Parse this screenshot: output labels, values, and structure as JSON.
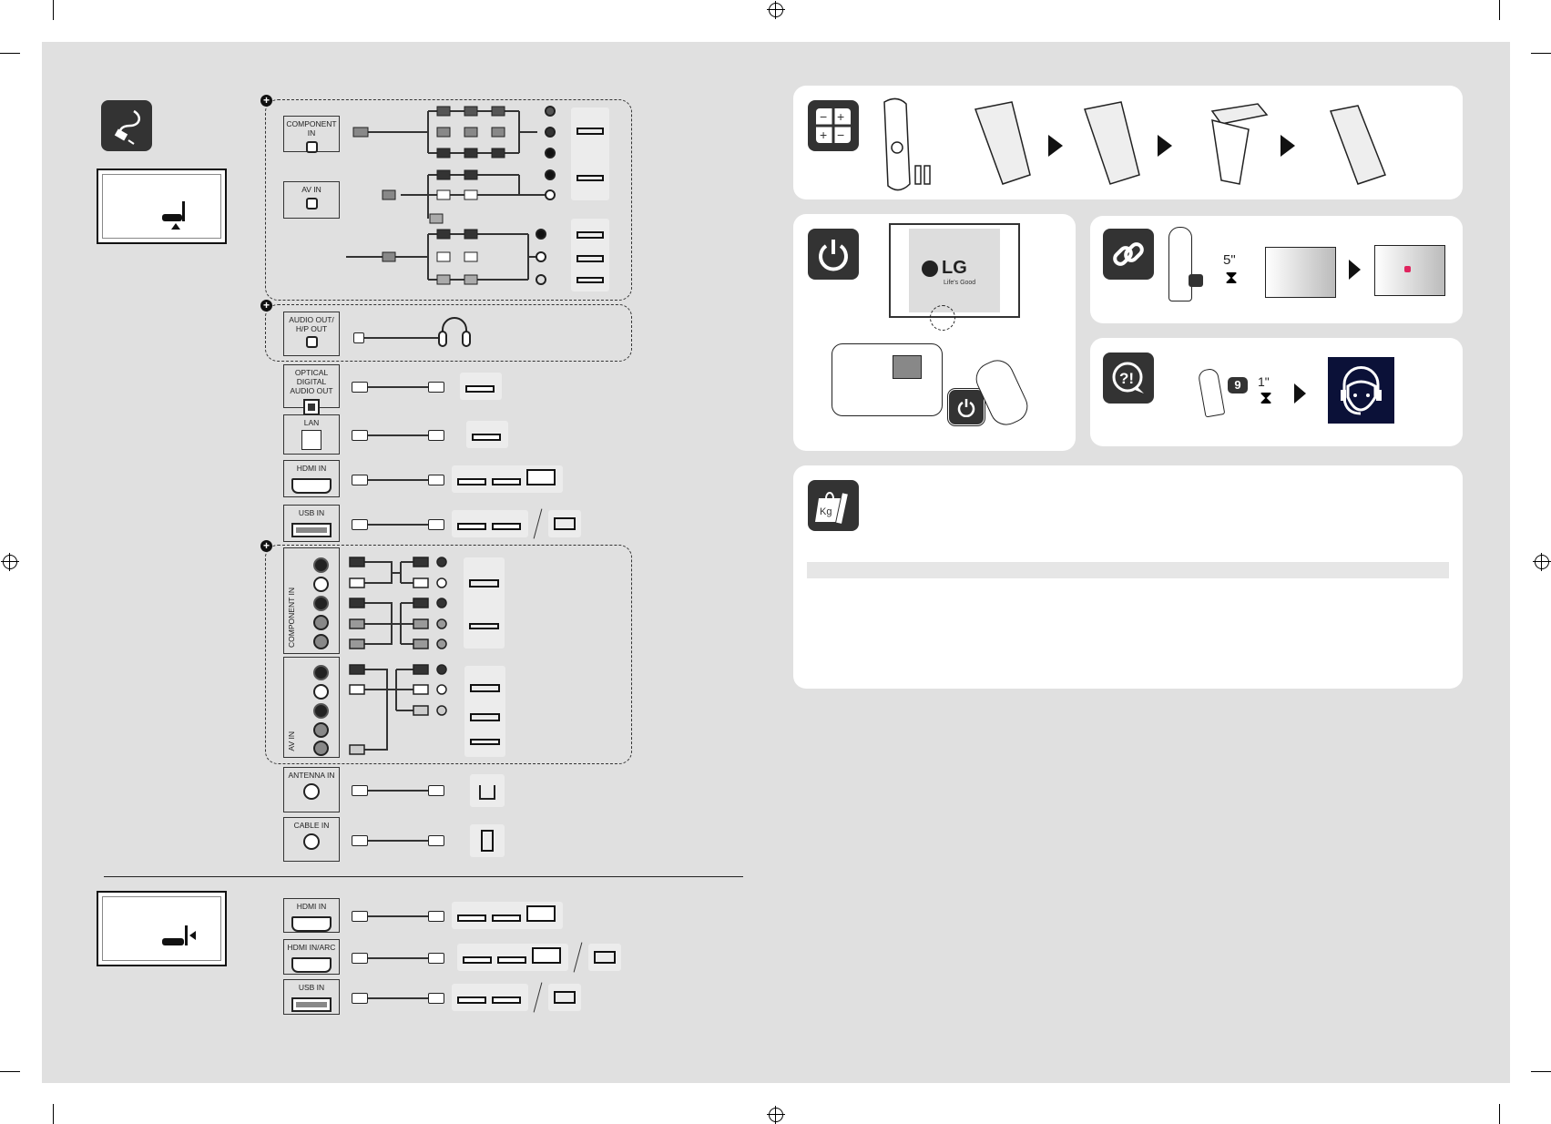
{
  "left_section": {
    "icon": "cable-plug-icon",
    "group_marker": "+",
    "ports_top": [
      {
        "id": "component-in",
        "label": "COMPONENT IN"
      },
      {
        "id": "av-in",
        "label": "AV IN"
      }
    ],
    "audio_out": {
      "label": "AUDIO OUT/ H/P OUT"
    },
    "ports_simple": [
      {
        "id": "optical",
        "label": "OPTICAL DIGITAL AUDIO OUT",
        "jack": "optical",
        "devices": [
          "speaker-system-icon"
        ]
      },
      {
        "id": "lan",
        "label": "LAN",
        "jack": "lan",
        "devices": [
          "router-icon"
        ]
      },
      {
        "id": "hdmi",
        "label": "HDMI IN",
        "jack": "hdmi",
        "devices": [
          "set-top-box-icon",
          "dvd-player-icon",
          "laptop-icon"
        ]
      },
      {
        "id": "usb",
        "label": "USB IN",
        "jack": "usb",
        "devices": [
          "hard-drive-icon",
          "external-disk-icon"
        ],
        "alt_device": "usb-stick-icon"
      }
    ],
    "rca_groups": [
      {
        "id": "component-rca",
        "label": "COMPONENT IN"
      },
      {
        "id": "av-rca",
        "label": "AV IN"
      }
    ],
    "rf_ports": [
      {
        "id": "antenna",
        "label": "ANTENNA IN",
        "device": "house-antenna-icon"
      },
      {
        "id": "cable",
        "label": "CABLE IN",
        "device": "wall-outlet-icon"
      }
    ],
    "side_ports": [
      {
        "id": "hdmi-side",
        "label": "HDMI IN",
        "devices": [
          "set-top-box-icon",
          "dvd-player-icon",
          "laptop-icon"
        ]
      },
      {
        "id": "hdmi-arc",
        "label": "HDMI IN/ARC",
        "devices": [
          "set-top-box-icon",
          "dvd-player-icon",
          "laptop-icon"
        ],
        "alt_device": "speaker-system-icon"
      },
      {
        "id": "usb-side",
        "label": "USB IN",
        "devices": [
          "hard-drive-icon",
          "external-disk-icon"
        ],
        "alt_device": "usb-stick-icon"
      }
    ]
  },
  "right_section": {
    "battery_panel": {
      "icon": "battery-icon"
    },
    "power_panel": {
      "icon": "power-icon",
      "logo_text": "LG",
      "tagline": "Life's Good"
    },
    "pairing_panel": {
      "icon": "link-icon",
      "hold_time": "5\""
    },
    "help_panel": {
      "icon": "help-chat-icon",
      "key": "9",
      "hold_time": "1\""
    },
    "weight_panel": {
      "icon": "weight-bag-icon",
      "icon_text": "Kg"
    }
  },
  "colors": {
    "sheet": "#e0e0e0",
    "icon_bg": "#333333",
    "panel": "#ffffff",
    "support_bg": "#0b1138",
    "indicator": "#e0245e"
  }
}
